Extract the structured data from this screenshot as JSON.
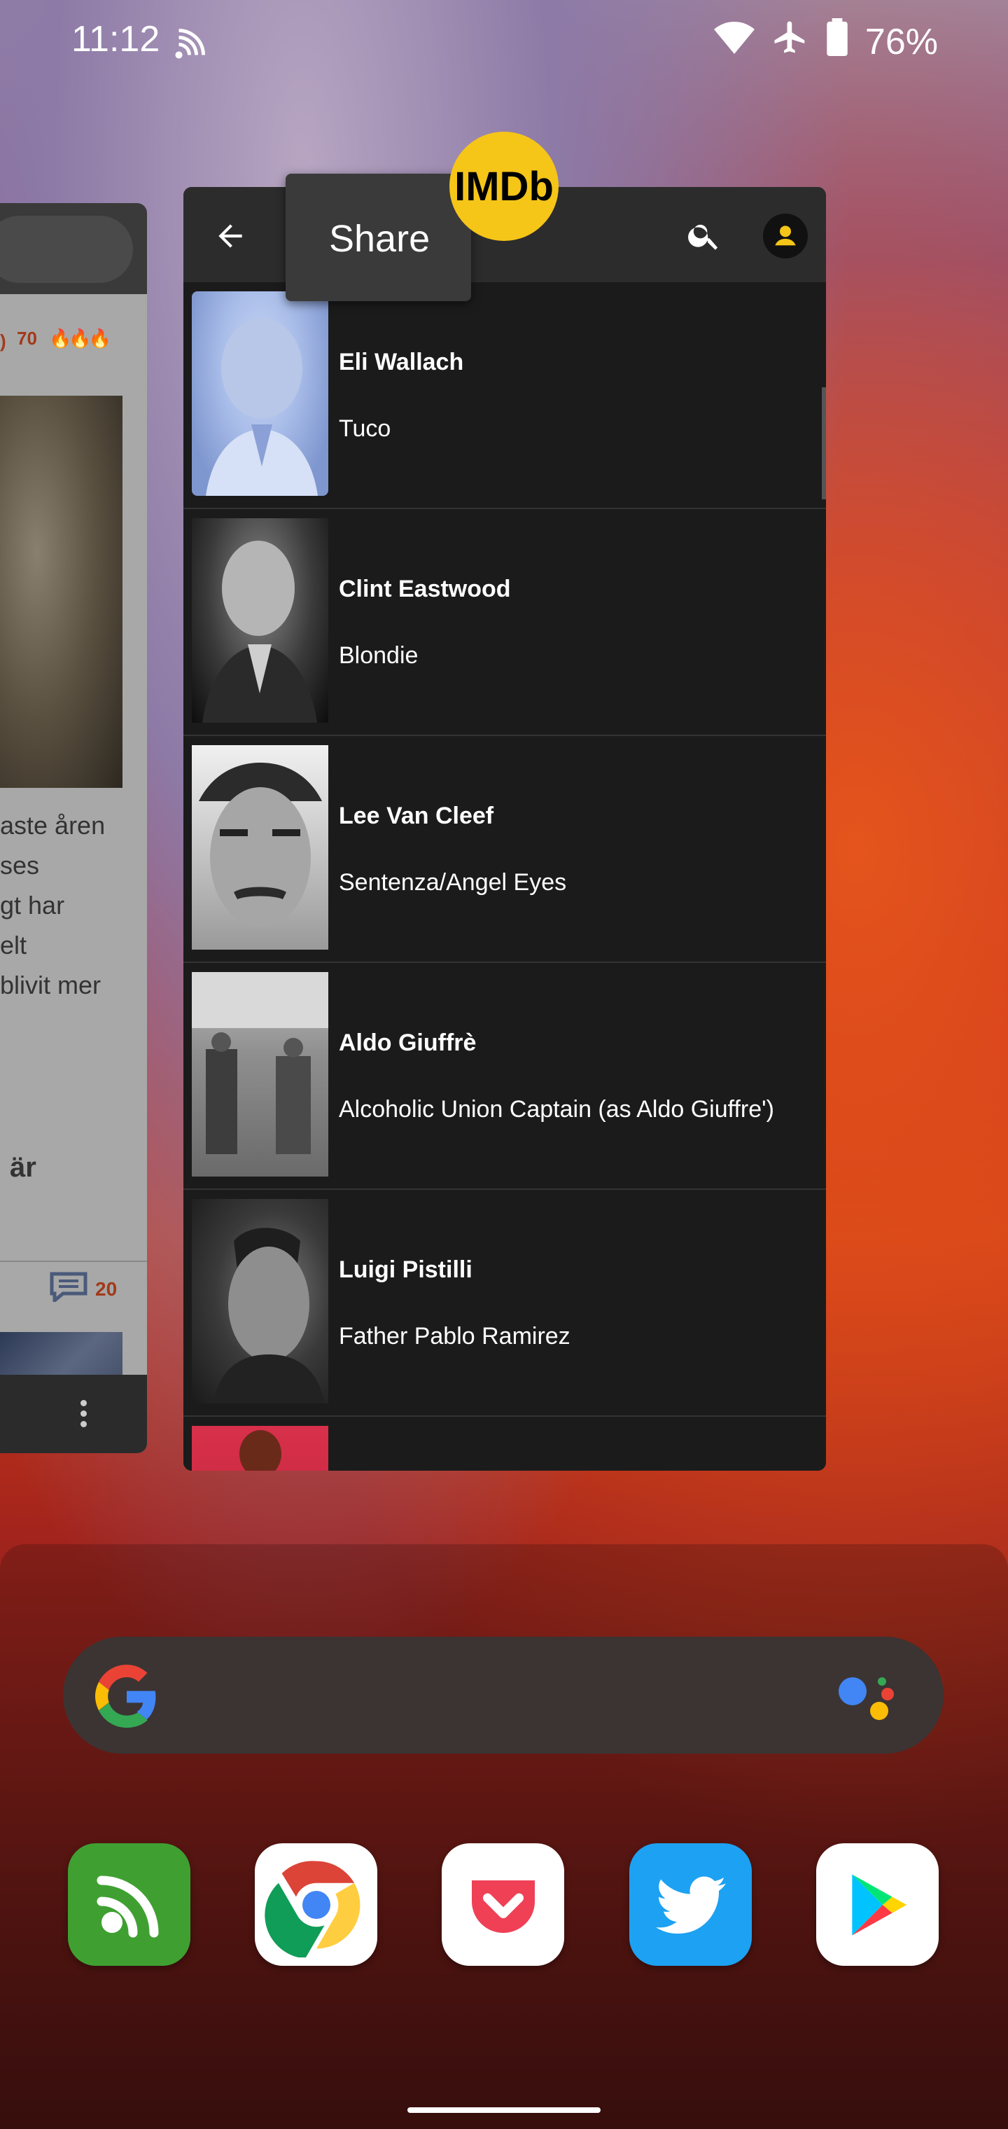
{
  "status_bar": {
    "time": "11:12",
    "battery": "76%",
    "icons": [
      "cast-icon",
      "wifi-icon",
      "airplane-icon",
      "battery-icon"
    ]
  },
  "left_card": {
    "stats_count": "70",
    "text_lines": [
      "aste åren",
      "ses",
      "gt har",
      "elt",
      "blivit mer"
    ],
    "bold_text": "är",
    "comment_count": "20"
  },
  "imdb_card": {
    "logo_text": "IMDb",
    "share_tooltip": "Share",
    "cast": [
      {
        "name": "Eli Wallach",
        "role": "Tuco"
      },
      {
        "name": "Clint Eastwood",
        "role": "Blondie"
      },
      {
        "name": "Lee Van Cleef",
        "role": "Sentenza/Angel Eyes"
      },
      {
        "name": "Aldo Giuffrè",
        "role": "Alcoholic Union Captain (as Aldo Giuffre')"
      },
      {
        "name": "Luigi Pistilli",
        "role": "Father Pablo Ramirez"
      }
    ]
  },
  "dock": {
    "apps": [
      "Feedly",
      "Chrome",
      "Pocket",
      "Twitter",
      "Play Store"
    ]
  },
  "colors": {
    "imdb_yellow": "#f5c518",
    "app_bar": "#2c2c2c",
    "list_bg": "#1b1b1b"
  }
}
